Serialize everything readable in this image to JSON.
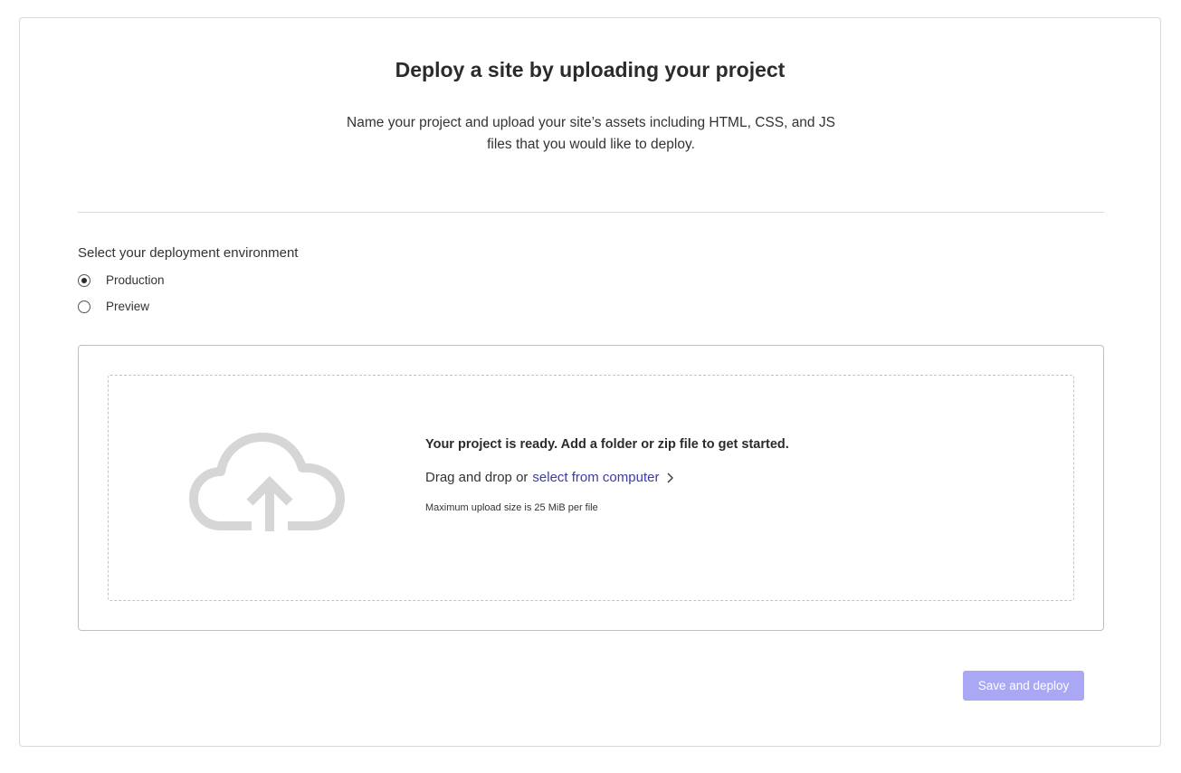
{
  "header": {
    "title": "Deploy a site by uploading your project",
    "subtitle": "Name your project and upload your site’s assets including HTML, CSS, and JS files that you would like to deploy."
  },
  "environment": {
    "label": "Select your deployment environment",
    "options": [
      {
        "label": "Production",
        "selected": true
      },
      {
        "label": "Preview",
        "selected": false
      }
    ]
  },
  "upload": {
    "icon": "cloud-upload-icon",
    "ready_text": "Your project is ready. Add a folder or zip file to get started.",
    "drag_text": "Drag and drop or",
    "select_link": "select from computer",
    "max_size": "Maximum upload size is 25 MiB per file"
  },
  "actions": {
    "deploy_label": "Save and deploy"
  },
  "colors": {
    "accent": "#3e3aa8",
    "button_disabled": "#aaa7f5",
    "icon_gray": "#d6d6d6"
  }
}
